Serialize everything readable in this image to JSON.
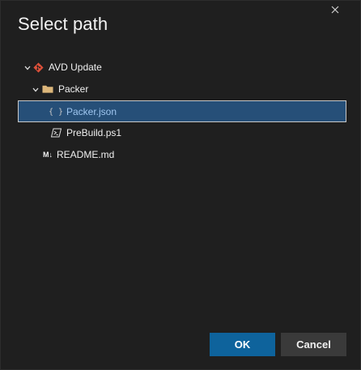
{
  "dialog": {
    "title": "Select path",
    "close_icon": "close-icon"
  },
  "tree": {
    "items": [
      {
        "label": "AVD Update",
        "icon": "git-repo-icon",
        "expanded": true,
        "level": 0
      },
      {
        "label": "Packer",
        "icon": "folder-icon",
        "expanded": true,
        "level": 1
      },
      {
        "label": "Packer.json",
        "icon": "json-file-icon",
        "glyph": "{ }",
        "level": 2,
        "selected": true
      },
      {
        "label": "PreBuild.ps1",
        "icon": "powershell-file-icon",
        "level": 2
      },
      {
        "label": "README.md",
        "icon": "markdown-file-icon",
        "glyph": "M↓",
        "level": 1
      }
    ]
  },
  "buttons": {
    "ok_label": "OK",
    "cancel_label": "Cancel"
  },
  "colors": {
    "background": "#1f1f1f",
    "selection": "#264f78",
    "accent": "#0e639c",
    "git_icon": "#e0513a",
    "folder_icon": "#dcb67a"
  }
}
